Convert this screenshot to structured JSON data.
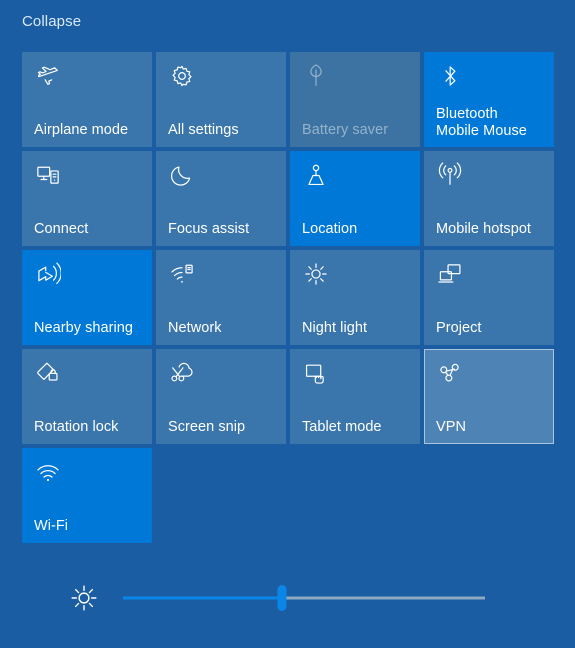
{
  "header": {
    "collapse_label": "Collapse"
  },
  "colors": {
    "panel_background": "#1a5da3",
    "tile_inactive": "#3a76ab",
    "tile_active": "#0078d7",
    "tile_hover": "#4e83b5",
    "tile_disabled_text": "#94b2cb",
    "slider_fill": "#0b86e8",
    "slider_track": "#8ea9c2",
    "text": "#ffffff",
    "link": "#dbe9f7"
  },
  "tiles": [
    {
      "label": "Airplane mode",
      "icon": "airplane-icon",
      "state": "off"
    },
    {
      "label": "All settings",
      "icon": "gear-icon",
      "state": "off"
    },
    {
      "label": "Battery saver",
      "icon": "battery-leaf-icon",
      "state": "disabled"
    },
    {
      "label": "Bluetooth\nMobile Mouse",
      "icon": "bluetooth-icon",
      "state": "on"
    },
    {
      "label": "Connect",
      "icon": "connect-icon",
      "state": "off"
    },
    {
      "label": "Focus assist",
      "icon": "moon-icon",
      "state": "off"
    },
    {
      "label": "Location",
      "icon": "location-icon",
      "state": "on"
    },
    {
      "label": "Mobile hotspot",
      "icon": "hotspot-icon",
      "state": "off"
    },
    {
      "label": "Nearby sharing",
      "icon": "nearby-sharing-icon",
      "state": "on"
    },
    {
      "label": "Network",
      "icon": "network-icon",
      "state": "off"
    },
    {
      "label": "Night light",
      "icon": "sun-icon",
      "state": "off"
    },
    {
      "label": "Project",
      "icon": "project-icon",
      "state": "off"
    },
    {
      "label": "Rotation lock",
      "icon": "rotation-lock-icon",
      "state": "off"
    },
    {
      "label": "Screen snip",
      "icon": "scissors-cloud-icon",
      "state": "off"
    },
    {
      "label": "Tablet mode",
      "icon": "tablet-icon",
      "state": "off"
    },
    {
      "label": "VPN",
      "icon": "vpn-icon",
      "state": "hover"
    },
    {
      "label": "Wi-Fi",
      "icon": "wifi-icon",
      "state": "on"
    }
  ],
  "brightness": {
    "icon": "brightness-icon",
    "value_percent": 44,
    "min": 0,
    "max": 100
  }
}
